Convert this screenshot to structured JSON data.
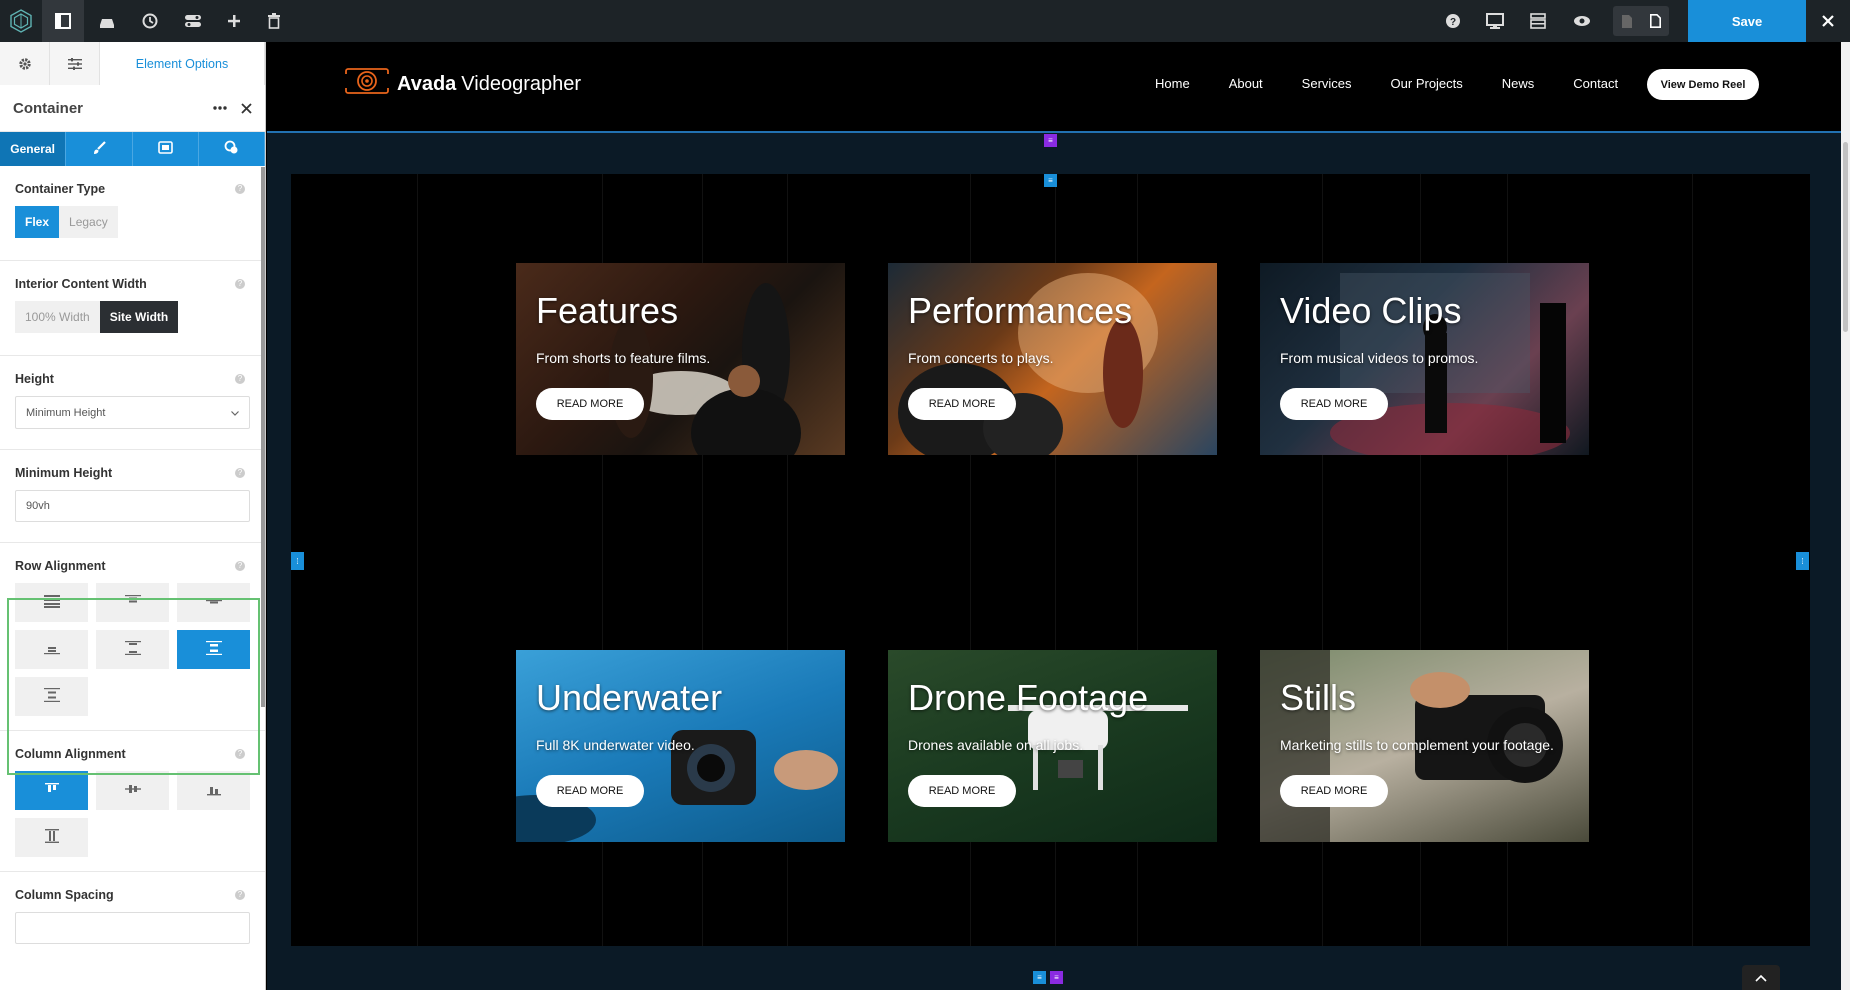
{
  "toolbar": {
    "icons": [
      "avada-logo-icon",
      "sidebar-panel-icon",
      "library-icon",
      "history-icon",
      "toggle-icon",
      "add-icon",
      "trash-icon",
      "help-icon",
      "desktop-icon",
      "layout-icon",
      "preview-icon",
      "page-icon",
      "page-filled-icon",
      "close-icon"
    ],
    "save_label": "Save"
  },
  "sidebar": {
    "top_tab_label": "Element Options",
    "header_title": "Container",
    "subtabs": {
      "general": "General"
    },
    "container_type": {
      "label": "Container Type",
      "options": [
        "Flex",
        "Legacy"
      ],
      "selected": "Flex"
    },
    "interior_width": {
      "label": "Interior Content Width",
      "options": [
        "100% Width",
        "Site Width"
      ],
      "selected": "Site Width"
    },
    "height": {
      "label": "Height",
      "value": "Minimum Height"
    },
    "min_height": {
      "label": "Minimum Height",
      "value": "90vh"
    },
    "row_alignment": {
      "label": "Row Alignment",
      "selected_index": 5
    },
    "column_alignment": {
      "label": "Column Alignment",
      "selected_index": 0
    },
    "column_spacing": {
      "label": "Column Spacing",
      "value": ""
    }
  },
  "site": {
    "brand_bold": "Avada",
    "brand_rest": "Videographer",
    "nav": [
      "Home",
      "About",
      "Services",
      "Our Projects",
      "News",
      "Contact"
    ],
    "cta": "View Demo Reel"
  },
  "cards": [
    {
      "title": "Features",
      "subtitle": "From shorts to feature films.",
      "button": "READ MORE"
    },
    {
      "title": "Performances",
      "subtitle": "From concerts to plays.",
      "button": "READ MORE"
    },
    {
      "title": "Video Clips",
      "subtitle": "From musical videos to promos.",
      "button": "READ MORE"
    },
    {
      "title": "Underwater",
      "subtitle": "Full 8K underwater video.",
      "button": "READ MORE"
    },
    {
      "title": "Drone Footage",
      "subtitle": "Drones available on all jobs.",
      "button": "READ MORE"
    },
    {
      "title": "Stills",
      "subtitle": "Marketing stills to complement your footage.",
      "button": "READ MORE"
    }
  ],
  "colors": {
    "accent": "#198fd9",
    "toolbar": "#1d2327",
    "highlight": "#65c172",
    "brand_orange": "#e8641b"
  }
}
